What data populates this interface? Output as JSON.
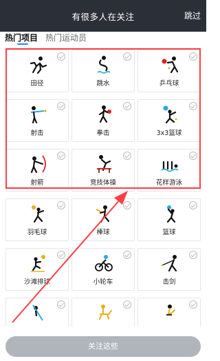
{
  "header": {
    "title": "有很多人在关注",
    "skip_label": "跳过"
  },
  "tabs": [
    {
      "label": "热门项目"
    },
    {
      "label": "热门运动员"
    }
  ],
  "colors": {
    "accent": "#1e86ff",
    "highlight": "#ff3e45",
    "header_bg": "#2b2f38",
    "button_bg": "#b0b4bb"
  },
  "sports": [
    {
      "label": "田径",
      "icon": "athletics-icon"
    },
    {
      "label": "跳水",
      "icon": "diving-icon"
    },
    {
      "label": "乒乓球",
      "icon": "table-tennis-icon"
    },
    {
      "label": "射击",
      "icon": "shooting-icon"
    },
    {
      "label": "拳击",
      "icon": "boxing-icon"
    },
    {
      "label": "3x3篮球",
      "icon": "basketball-3x3-icon"
    },
    {
      "label": "射箭",
      "icon": "archery-icon"
    },
    {
      "label": "竞技体操",
      "icon": "gymnastics-icon"
    },
    {
      "label": "花样游泳",
      "icon": "artistic-swimming-icon"
    },
    {
      "label": "羽毛球",
      "icon": "badminton-icon"
    },
    {
      "label": "棒球",
      "icon": "baseball-icon"
    },
    {
      "label": "篮球",
      "icon": "basketball-icon"
    },
    {
      "label": "沙滩排球",
      "icon": "beach-volleyball-icon"
    },
    {
      "label": "小轮车",
      "icon": "bmx-icon"
    },
    {
      "label": "击剑",
      "icon": "fencing-icon"
    },
    {
      "label": "",
      "icon": "canoe-icon"
    },
    {
      "label": "",
      "icon": "equestrian-icon"
    },
    {
      "label": "",
      "icon": "cycling-icon"
    }
  ],
  "footer": {
    "button_label": "关注这些"
  }
}
